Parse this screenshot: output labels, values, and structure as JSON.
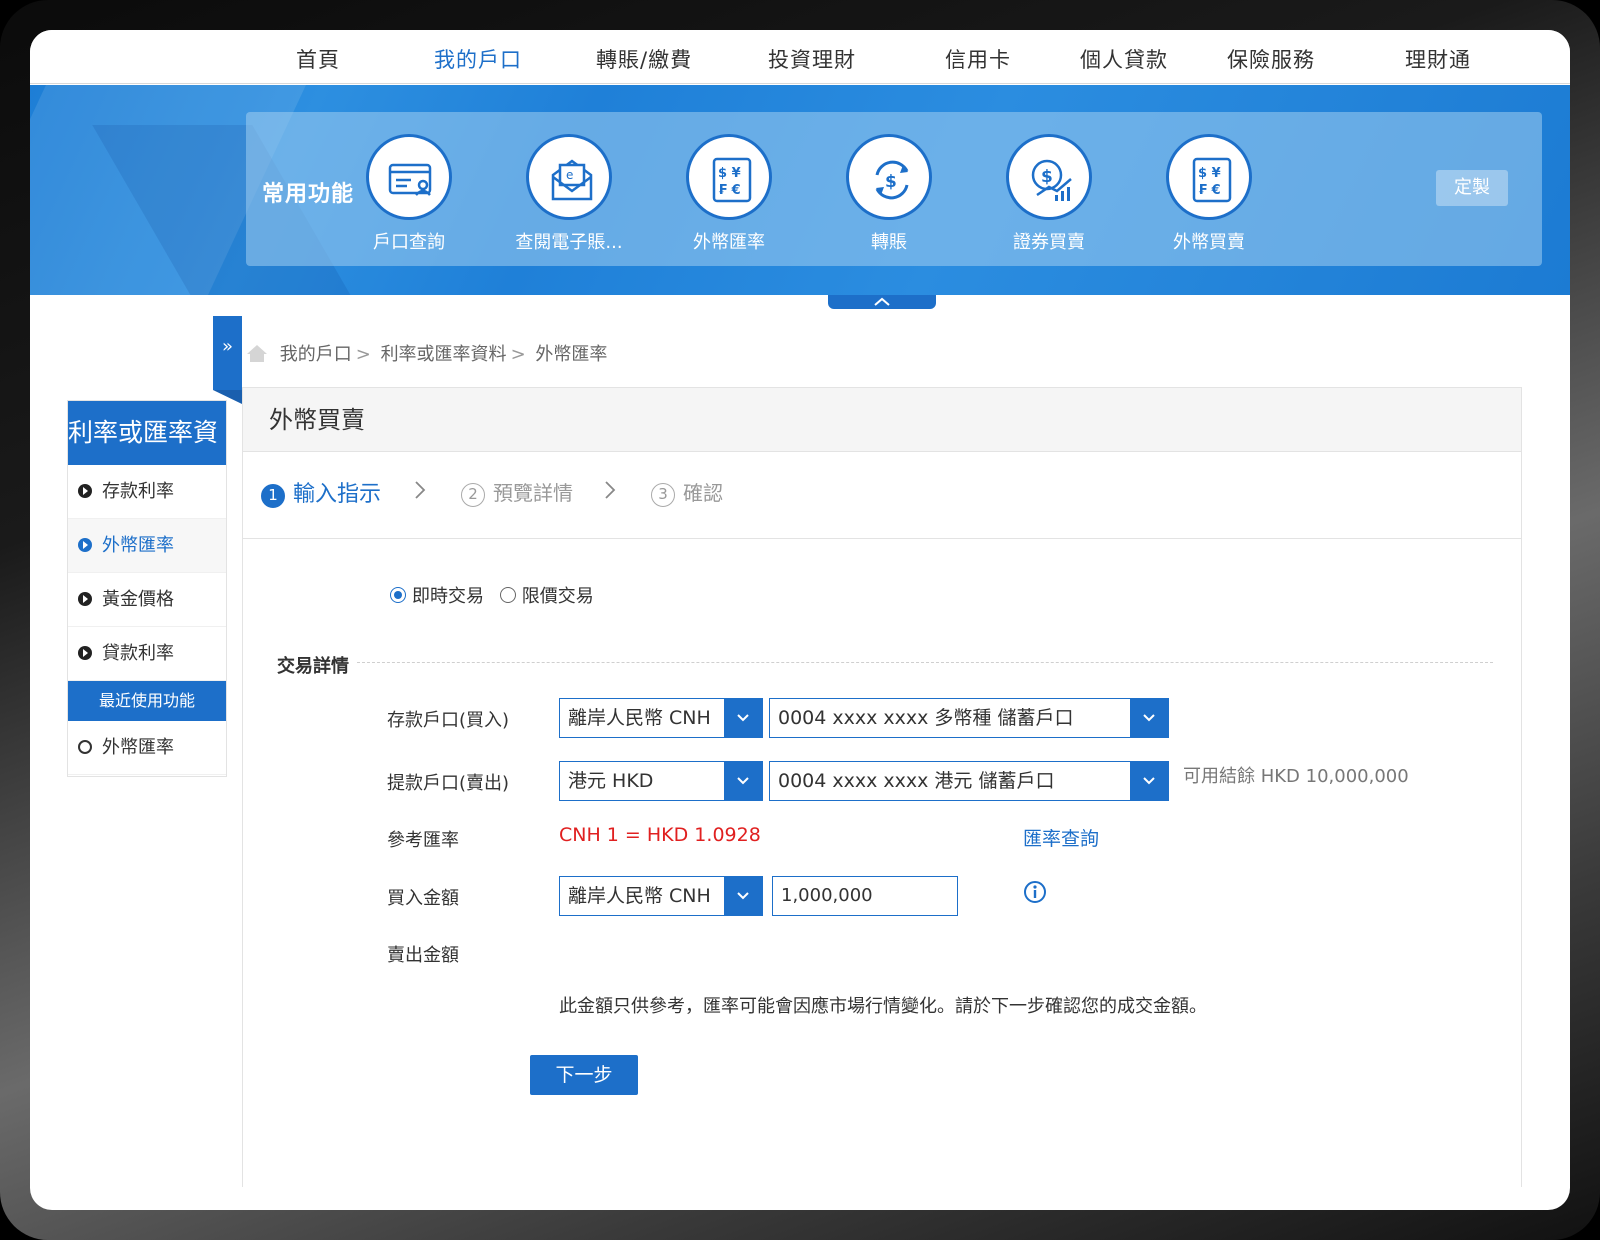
{
  "topnav": {
    "items": [
      "首頁",
      "我的戶口",
      "轉賬/繳費",
      "投資理財",
      "信用卡",
      "個人貸款",
      "保險服務",
      "理財通"
    ],
    "active_index": 1
  },
  "quick": {
    "title": "常用功能",
    "items": [
      {
        "label": "戶口查詢",
        "icon": "account-card-icon"
      },
      {
        "label": "查閱電子賬...",
        "icon": "e-statement-icon"
      },
      {
        "label": "外幣匯率",
        "icon": "currency-rate-icon"
      },
      {
        "label": "轉賬",
        "icon": "transfer-icon"
      },
      {
        "label": "證券買賣",
        "icon": "securities-icon"
      },
      {
        "label": "外幣買賣",
        "icon": "currency-exchange-icon"
      }
    ],
    "customize": "定製"
  },
  "breadcrumb": {
    "items": [
      "我的戶口",
      "利率或匯率資料",
      "外幣匯率"
    ],
    "separator": ">"
  },
  "leftmenu": {
    "title": "利率或匯率資",
    "items": [
      "存款利率",
      "外幣匯率",
      "黃金價格",
      "貸款利率"
    ],
    "active_index": 1,
    "recent_title": "最近使用功能",
    "recent_items": [
      "外幣匯率"
    ]
  },
  "main": {
    "title": "外幣買賣",
    "steps": [
      {
        "num": "1",
        "label": "輸入指示"
      },
      {
        "num": "2",
        "label": "預覽詳情"
      },
      {
        "num": "3",
        "label": "確認"
      }
    ],
    "radios": [
      {
        "label": "即時交易",
        "checked": true
      },
      {
        "label": "限價交易",
        "checked": false
      }
    ],
    "section": "交易詳情",
    "deposit": {
      "label": "存款戶口(買入)",
      "currency": "離岸人民幣 CNH",
      "account": "0004 xxxx xxxx 多幣種 儲蓄戶口"
    },
    "withdraw": {
      "label": "提款戶口(賣出)",
      "currency": "港元 HKD",
      "account": "0004 xxxx xxxx 港元 儲蓄戶口",
      "available": "可用結餘 HKD 10,000,000"
    },
    "ref_rate": {
      "label": "參考匯率",
      "value": "CNH 1 = HKD 1.0928",
      "link": "匯率查詢"
    },
    "buy": {
      "label": "買入金額",
      "currency": "離岸人民幣 CNH",
      "amount": "1,000,000"
    },
    "sell": {
      "label": "賣出金額"
    },
    "note": "此金額只供參考，匯率可能會因應市場行情變化。請於下一步確認您的成交金額。",
    "next": "下一步"
  },
  "colors": {
    "primary": "#1d6fc9",
    "rate": "#e02020"
  }
}
